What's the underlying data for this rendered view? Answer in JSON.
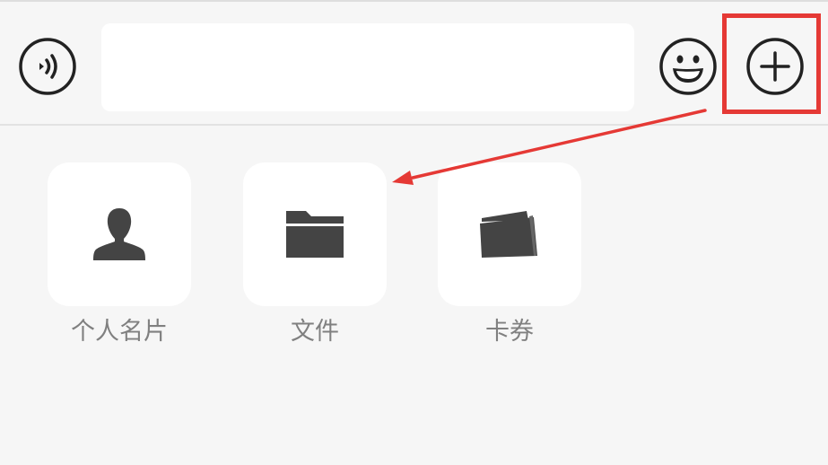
{
  "input_bar": {
    "voice_icon": "voice-icon",
    "input_value": "",
    "emoji_icon": "emoji-icon",
    "plus_icon": "plus-icon"
  },
  "panel": {
    "items": [
      {
        "label": "个人名片",
        "icon": "person-icon"
      },
      {
        "label": "文件",
        "icon": "folder-icon"
      },
      {
        "label": "卡券",
        "icon": "wallet-icon"
      }
    ]
  },
  "annotation": {
    "highlight_color": "#e53935",
    "arrow_color": "#e53935"
  },
  "colors": {
    "background": "#f6f6f6",
    "tile": "#ffffff",
    "icon": "#444444",
    "label": "#808080"
  }
}
